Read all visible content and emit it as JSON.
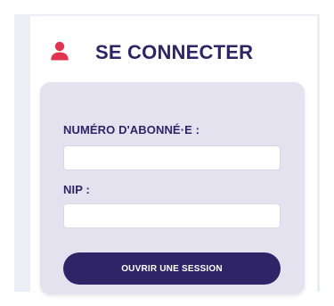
{
  "login": {
    "title": "SE CONNECTER",
    "subscriber_label": "NUMÉRO D'ABONNÉ·E :",
    "subscriber_value": "",
    "pin_label": "NIP :",
    "pin_value": "",
    "submit_label": "OUVRIR UNE SESSION"
  },
  "icons": {
    "header": "user-icon"
  },
  "colors": {
    "brand": "#2f2566",
    "icon": "#e0344f",
    "panel": "#e4e2ef",
    "background": "#eceef5"
  }
}
